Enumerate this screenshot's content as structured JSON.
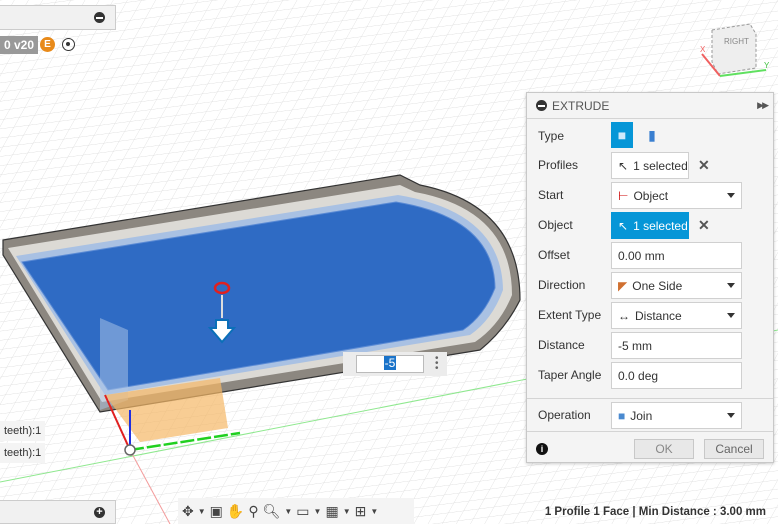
{
  "top": {
    "version_label": "0 v20",
    "user_initial": "E"
  },
  "browser_tags": [
    "teeth):1",
    "teeth):1"
  ],
  "viewcube": {
    "face_label": "RIGHT",
    "axis_x": "X",
    "axis_y": "Y"
  },
  "dimension_input": {
    "value": "-5"
  },
  "extrude": {
    "title": "EXTRUDE",
    "rows": {
      "type": {
        "label": "Type"
      },
      "profiles": {
        "label": "Profiles",
        "value": "1 selected"
      },
      "start": {
        "label": "Start",
        "value": "Object"
      },
      "object": {
        "label": "Object",
        "value": "1 selected"
      },
      "offset": {
        "label": "Offset",
        "value": "0.00 mm"
      },
      "direction": {
        "label": "Direction",
        "value": "One Side"
      },
      "extent_type": {
        "label": "Extent Type",
        "value": "Distance"
      },
      "distance": {
        "label": "Distance",
        "value": "-5 mm"
      },
      "taper_angle": {
        "label": "Taper Angle",
        "value": "0.0 deg"
      },
      "operation": {
        "label": "Operation",
        "value": "Join"
      }
    },
    "ok_label": "OK",
    "cancel_label": "Cancel"
  },
  "status_text": "1 Profile 1 Face | Min Distance : 3.00 mm",
  "colors": {
    "accent": "#0696d7",
    "face": "#2f6bc4"
  }
}
